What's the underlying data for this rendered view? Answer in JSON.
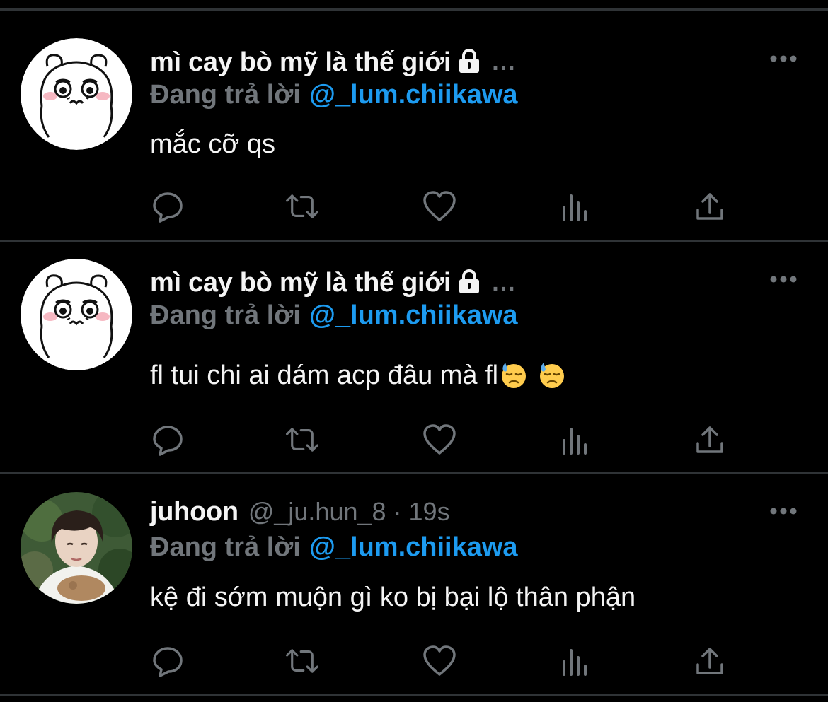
{
  "tweets": [
    {
      "display_name": "mì cay bò mỹ là thế giới",
      "ellipsis": "...",
      "reply_label": "Đang trả lời",
      "reply_mention": "@_lum.chiikawa",
      "text": "mắc cỡ qs",
      "avatar_icon": "hamster-avatar-icon",
      "locked": true
    },
    {
      "display_name": "mì cay bò mỹ là thế giới",
      "ellipsis": "...",
      "reply_label": "Đang trả lời",
      "reply_mention": "@_lum.chiikawa",
      "text": "fl tui chi ai dám acp đâu mà fl",
      "emojis": [
        "downcast-face-with-sweat-icon",
        "downcast-face-with-sweat-icon"
      ],
      "avatar_icon": "hamster-avatar-icon",
      "locked": true
    },
    {
      "display_name": "juhoon",
      "handle": "@_ju.hun_8",
      "separator": "·",
      "time": "19s",
      "reply_label": "Đang trả lời",
      "reply_mention": "@_lum.chiikawa",
      "text": "kệ đi sớm muộn gì ko bị bại lộ thân phận",
      "avatar_icon": "user-photo-avatar"
    }
  ],
  "action_icons": [
    "reply-icon",
    "retweet-icon",
    "like-icon",
    "views-icon",
    "share-icon"
  ],
  "colors": {
    "background": "#000000",
    "text": "#f4f4f4",
    "muted": "#71767b",
    "mention": "#1d9bf0",
    "divider": "#2f3336"
  }
}
